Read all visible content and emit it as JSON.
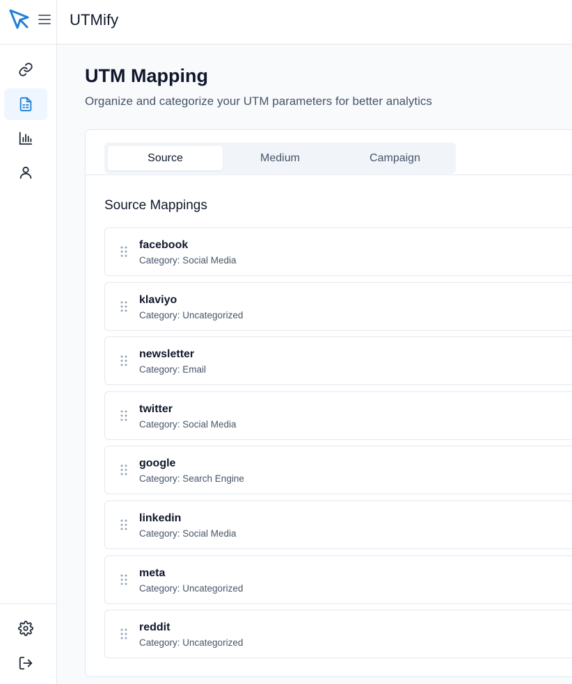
{
  "app": {
    "title": "UTMify"
  },
  "colors": {
    "accent": "#1d7fd6",
    "active_nav_bg": "#eff6ff"
  },
  "sidebar": {
    "items": [
      {
        "icon": "link-icon"
      },
      {
        "icon": "document-icon",
        "active": true
      },
      {
        "icon": "bar-chart-icon"
      },
      {
        "icon": "user-icon"
      }
    ],
    "bottom_items": [
      {
        "icon": "gear-icon"
      },
      {
        "icon": "logout-icon"
      }
    ]
  },
  "page": {
    "title": "UTM Mapping",
    "subtitle": "Organize and categorize your UTM parameters for better analytics"
  },
  "tabs": [
    {
      "label": "Source",
      "active": true
    },
    {
      "label": "Medium"
    },
    {
      "label": "Campaign"
    }
  ],
  "section": {
    "title": "Source Mappings"
  },
  "mappings": [
    {
      "name": "facebook",
      "category": "Category: Social Media"
    },
    {
      "name": "klaviyo",
      "category": "Category: Uncategorized"
    },
    {
      "name": "newsletter",
      "category": "Category: Email"
    },
    {
      "name": "twitter",
      "category": "Category: Social Media"
    },
    {
      "name": "google",
      "category": "Category: Search Engine"
    },
    {
      "name": "linkedin",
      "category": "Category: Social Media"
    },
    {
      "name": "meta",
      "category": "Category: Uncategorized"
    },
    {
      "name": "reddit",
      "category": "Category: Uncategorized"
    }
  ]
}
